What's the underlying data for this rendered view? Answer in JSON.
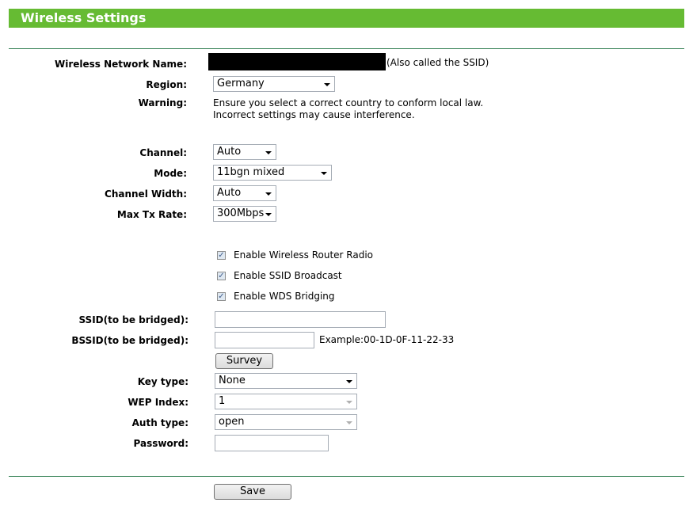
{
  "page": {
    "title": "Wireless Settings"
  },
  "fields": {
    "network_name_label": "Wireless Network Name:",
    "network_name_hint": "(Also called the SSID)",
    "region_label": "Region:",
    "region_value": "Germany",
    "warning_label": "Warning:",
    "warning_line1": "Ensure you select a correct country to conform local law.",
    "warning_line2": "Incorrect settings may cause interference.",
    "channel_label": "Channel:",
    "channel_value": "Auto",
    "mode_label": "Mode:",
    "mode_value": "11bgn mixed",
    "channel_width_label": "Channel Width:",
    "channel_width_value": "Auto",
    "max_tx_label": "Max Tx Rate:",
    "max_tx_value": "300Mbps"
  },
  "checkboxes": {
    "radio": {
      "label": "Enable Wireless Router Radio",
      "checked": true
    },
    "ssid_broadcast": {
      "label": "Enable SSID Broadcast",
      "checked": true
    },
    "wds": {
      "label": "Enable WDS Bridging",
      "checked": true
    }
  },
  "wds": {
    "ssid_label": "SSID(to be bridged):",
    "ssid_value": "",
    "bssid_label": "BSSID(to be bridged):",
    "bssid_value": "",
    "bssid_example": "Example:00-1D-0F-11-22-33",
    "survey_label": "Survey",
    "key_type_label": "Key type:",
    "key_type_value": "None",
    "wep_index_label": "WEP Index:",
    "wep_index_value": "1",
    "auth_type_label": "Auth type:",
    "auth_type_value": "open",
    "password_label": "Password:",
    "password_value": ""
  },
  "footer": {
    "save_label": "Save"
  },
  "colors": {
    "title_bg": "#66bb33",
    "rule": "#2e7d4f"
  }
}
